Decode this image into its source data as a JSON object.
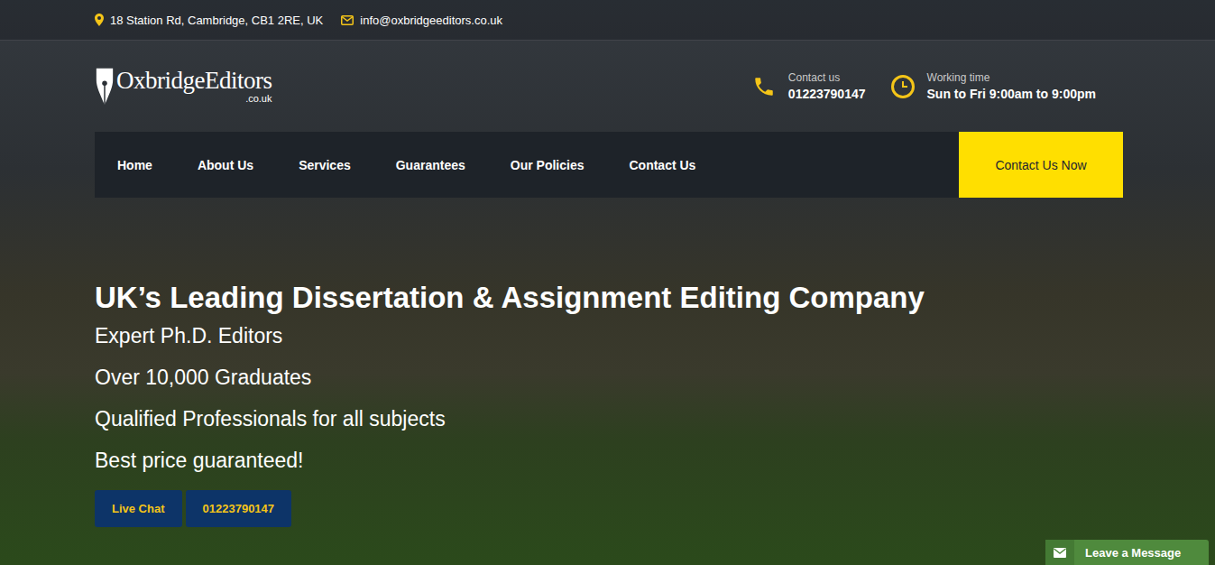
{
  "topbar": {
    "address": "18 Station Rd, Cambridge, CB1 2RE, UK",
    "email": "info@oxbridgeeditors.co.uk"
  },
  "logo": {
    "name": "OxbridgeEditors",
    "suffix": ".co.uk"
  },
  "contacts": [
    {
      "kind": "phone",
      "label": "Contact us",
      "value": "01223790147"
    },
    {
      "kind": "clock",
      "label": "Working time",
      "value": "Sun to Fri 9:00am to 9:00pm"
    }
  ],
  "nav": {
    "items": [
      "Home",
      "About Us",
      "Services",
      "Guarantees",
      "Our Policies",
      "Contact Us"
    ]
  },
  "cta": "Contact Us Now",
  "hero": {
    "title": "UK’s Leading Dissertation & Assignment Editing Company",
    "points": [
      "Expert Ph.D. Editors",
      "Over 10,000 Graduates",
      "Qualified Professionals for all subjects",
      "Best price guaranteed!"
    ],
    "buttons": [
      "Live Chat",
      "01223790147"
    ]
  },
  "message_tab": "Leave a Message"
}
